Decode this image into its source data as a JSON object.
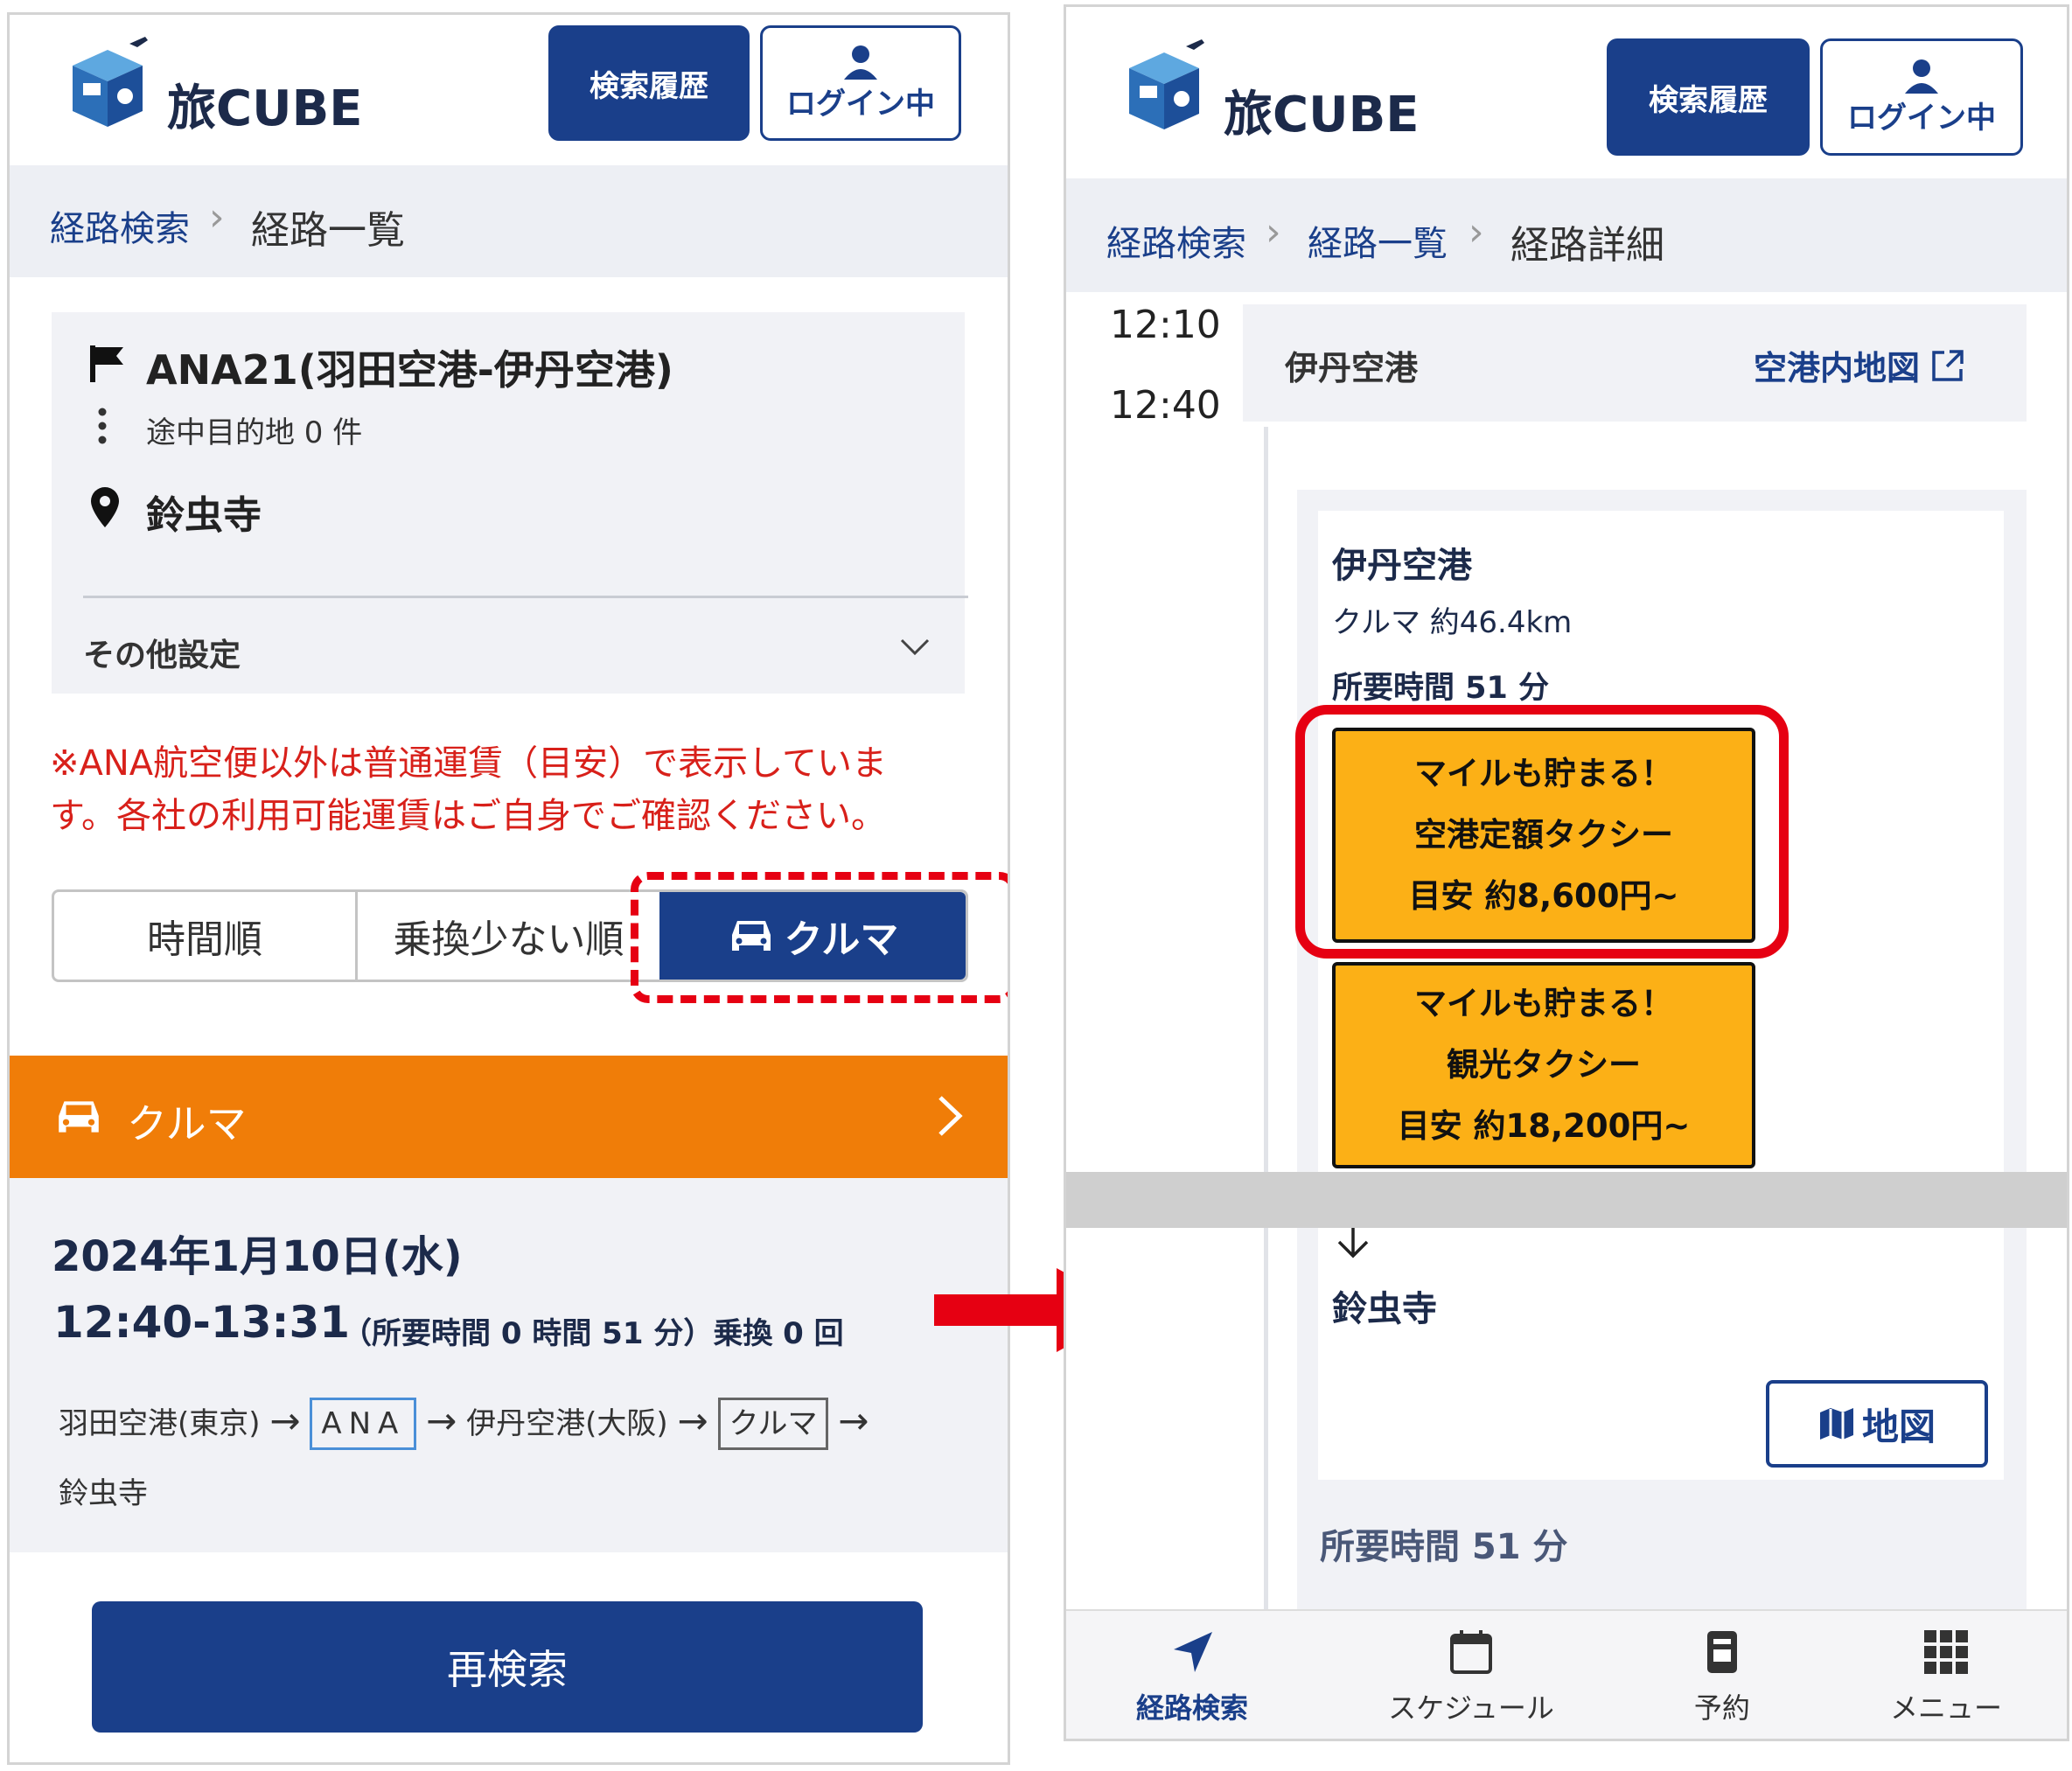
{
  "left": {
    "logo": "旅CUBE",
    "header": {
      "history_btn": "検索履歴",
      "login_btn": "ログイン中"
    },
    "breadcrumb": {
      "link": "経路検索",
      "current": "経路一覧"
    },
    "route": {
      "title": "ANA21(羽田空港-伊丹空港)",
      "waypoints": "途中目的地 0 件",
      "destination": "鈴虫寺",
      "other_settings": "その他設定"
    },
    "notice": "※ANA航空便以外は普通運賃（目安）で表示しています。各社の利用可能運賃はご自身でご確認ください。",
    "sort_tabs": {
      "time": "時間順",
      "fewer_transfers": "乗換少ない順",
      "car": "クルマ"
    },
    "car_bar": {
      "label": "クルマ"
    },
    "result": {
      "date": "2024年1月10日(水)",
      "time_range": "12:40-13:31",
      "duration_info": "（所要時間 0 時間 51 分）乗換 0 回",
      "path": [
        "羽田空港(東京)",
        "ANA",
        "伊丹空港(大阪)",
        "クルマ",
        "鈴虫寺"
      ]
    },
    "research_btn": "再検索"
  },
  "right": {
    "logo": "旅CUBE",
    "header": {
      "history_btn": "検索履歴",
      "login_btn": "ログイン中"
    },
    "breadcrumb": {
      "link1": "経路検索",
      "link2": "経路一覧",
      "current": "経路詳細"
    },
    "times": {
      "start": "12:10",
      "end": "12:40"
    },
    "airport": {
      "name": "伊丹空港",
      "map_link": "空港内地図"
    },
    "detail": {
      "from": "伊丹空港",
      "mode": "クルマ 約46.4km",
      "duration": "所要時間 51 分",
      "to": "鈴虫寺",
      "map_btn": "地図",
      "duration_bottom": "所要時間 51 分"
    },
    "taxi1": {
      "line1": "マイルも貯まる！",
      "line2": "空港定額タクシー",
      "line3": "目安 約8,600円~"
    },
    "taxi2": {
      "line1": "マイルも貯まる！",
      "line2": "観光タクシー",
      "line3": "目安 約18,200円~"
    },
    "bottom_nav": [
      "経路検索",
      "スケジュール",
      "予約",
      "メニュー"
    ]
  },
  "colors": {
    "navy": "#1a3f8a",
    "orange": "#f07d08",
    "taxi_yellow": "#fcb016",
    "highlight_red": "#e60012",
    "notice_red": "#d8201a"
  }
}
